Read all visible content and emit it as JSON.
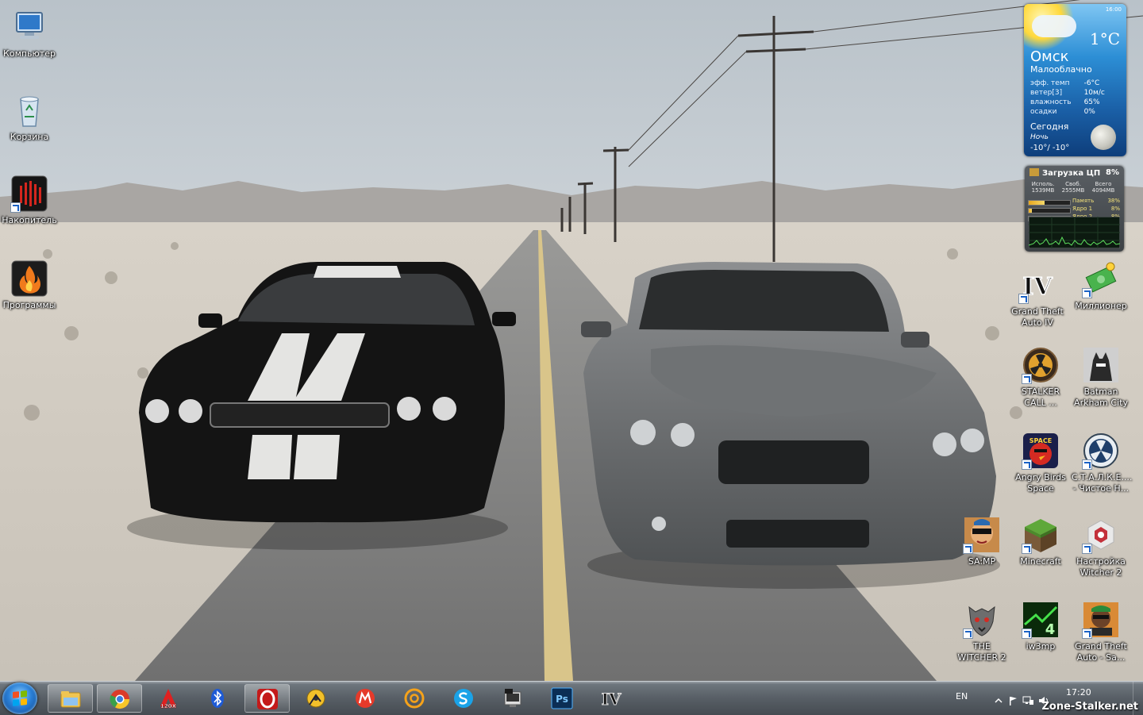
{
  "desktop_left": [
    {
      "label": "Компьютер",
      "icon": "computer-icon"
    },
    {
      "label": "Корзина",
      "icon": "recycle-bin-icon"
    },
    {
      "label": "Накопитель",
      "icon": "accumulator-icon"
    },
    {
      "label": "Программы",
      "icon": "programs-icon"
    }
  ],
  "desktop_right": [
    {
      "label": "Grand Theft Auto IV",
      "icon": "gta4-icon"
    },
    {
      "label": "Миллионер",
      "icon": "millionaire-icon"
    },
    {
      "label": "STALKER CALL ...",
      "icon": "stalker-icon"
    },
    {
      "label": "Batman Arkham City",
      "icon": "batman-icon"
    },
    {
      "label": "Angry Birds Space",
      "icon": "angry-birds-icon"
    },
    {
      "label": "С.Т.А.Л.К.Е.... - Чистое Н...",
      "icon": "stalker-clear-sky-icon"
    },
    {
      "label": "SA:MP",
      "icon": "samp-icon"
    },
    {
      "label": "Minecraft",
      "icon": "minecraft-icon"
    },
    {
      "label": "Настройка Witcher 2",
      "icon": "witcher-config-icon"
    },
    {
      "label": "THE WITCHER 2",
      "icon": "witcher2-icon"
    },
    {
      "label": "iw3mp",
      "icon": "iw3mp-icon"
    },
    {
      "label": "Grand Theft Auto - Sa...",
      "icon": "gta-sa-icon"
    }
  ],
  "weather": {
    "time": "16:00",
    "temp": "1°C",
    "city": "Омск",
    "condition": "Малооблачно",
    "rows": [
      {
        "k": "эфф. темп",
        "v": "-6°C"
      },
      {
        "k": "ветер[3]",
        "v": "10м/с"
      },
      {
        "k": "влажность",
        "v": "65%"
      },
      {
        "k": "осадки",
        "v": "0%"
      }
    ],
    "today": "Сегодня",
    "night": "Ночь",
    "range": "-10°/ -10°"
  },
  "cpu": {
    "title": "Загрузка ЦП",
    "percent": "8%",
    "col_labels": [
      "Исполь.",
      "Своб.",
      "Всего"
    ],
    "col_values": [
      "1539MB",
      "2555MB",
      "4094MB"
    ],
    "rows": [
      {
        "label": "Память",
        "value": "38%",
        "level": 0.38
      },
      {
        "label": "Ядро 1",
        "value": "8%",
        "level": 0.08
      },
      {
        "label": "Ядро 2",
        "value": "8%",
        "level": 0.08
      }
    ]
  },
  "taskbar": {
    "apps": [
      {
        "name": "Проводник",
        "icon": "explorer-icon"
      },
      {
        "name": "Google Chrome",
        "icon": "chrome-icon"
      },
      {
        "name": "120x",
        "icon": "app-120x-icon"
      },
      {
        "name": "Bluetooth",
        "icon": "bluetooth-icon"
      },
      {
        "name": "Opera",
        "icon": "opera-icon"
      },
      {
        "name": "Daemon Tools",
        "icon": "daemon-tools-icon"
      },
      {
        "name": "Mail.ru Агент",
        "icon": "mailru-agent-icon"
      },
      {
        "name": "Mail.ru",
        "icon": "mailru-icon"
      },
      {
        "name": "Skype",
        "icon": "skype-icon"
      },
      {
        "name": "AIMP",
        "icon": "aimp-icon"
      },
      {
        "name": "Photoshop",
        "icon": "photoshop-icon"
      },
      {
        "name": "GTA IV",
        "icon": "gta4-taskbar-icon"
      }
    ],
    "photoshop_label": "Ps",
    "gta_label": "IV",
    "app120_label": "120X",
    "lang": "EN",
    "clock": "17:20",
    "watermark": "Zone-Stalker.net"
  },
  "gta4_label": "IV"
}
